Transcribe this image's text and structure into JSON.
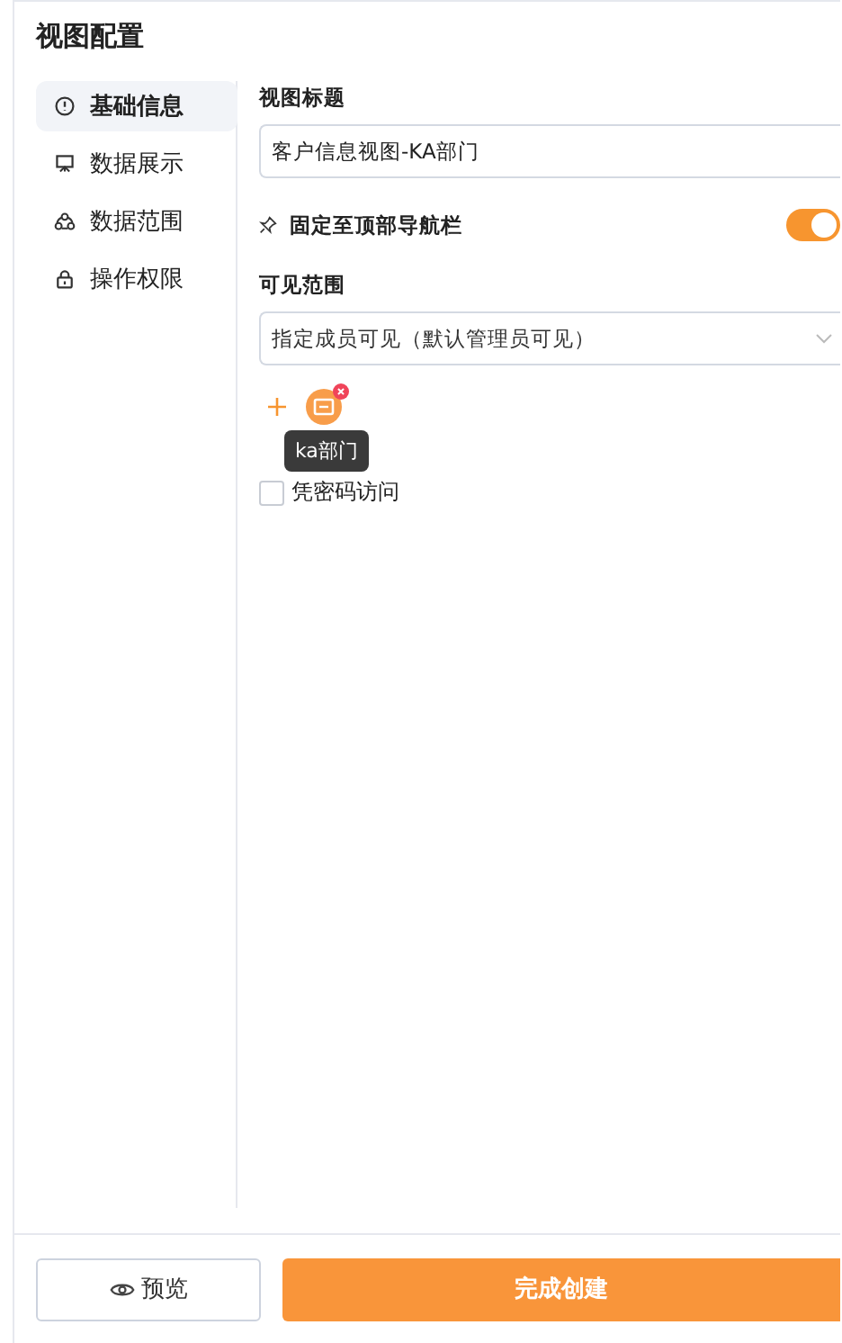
{
  "title": "视图配置",
  "sidebar": {
    "items": [
      {
        "label": "基础信息",
        "selected": true
      },
      {
        "label": "数据展示",
        "selected": false
      },
      {
        "label": "数据范围",
        "selected": false
      },
      {
        "label": "操作权限",
        "selected": false
      }
    ]
  },
  "form": {
    "title_label": "视图标题",
    "title_value": "客户信息视图-KA部门",
    "pin_label": "固定至顶部导航栏",
    "pin_on": true,
    "visibility_label": "可见范围",
    "visibility_value": "指定成员可见（默认管理员可见）",
    "member_tooltip": "ka部门",
    "password_label": "凭密码访问",
    "password_checked": false
  },
  "buttons": {
    "preview": "预览",
    "create": "完成创建"
  }
}
